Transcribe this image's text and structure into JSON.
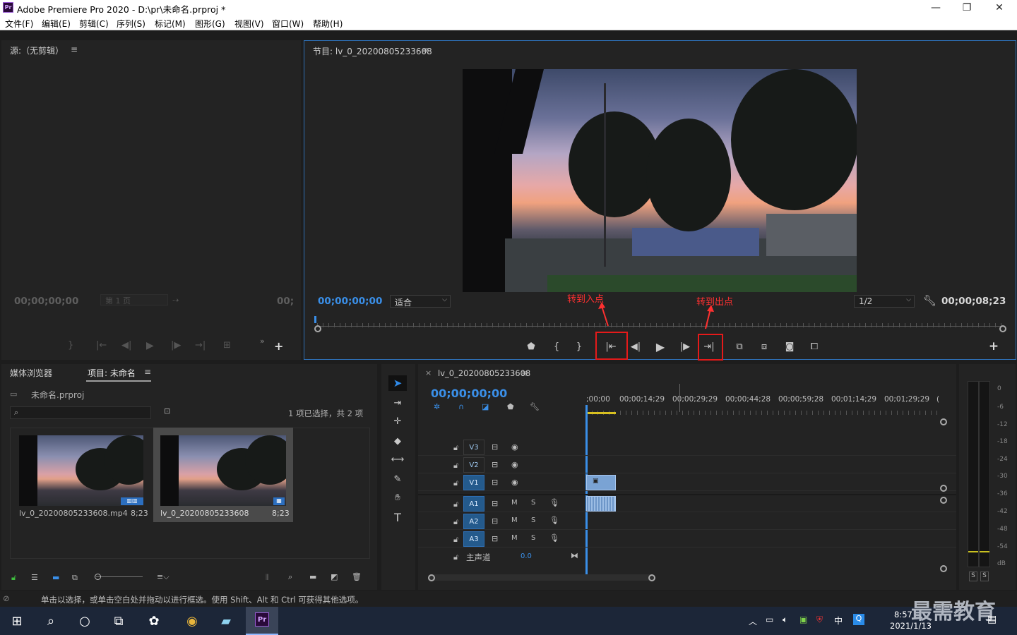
{
  "window": {
    "app_badge": "Pr",
    "title": "Adobe Premiere Pro 2020 - D:\\pr\\未命名.prproj *",
    "min": "—",
    "max": "❐",
    "close": "✕"
  },
  "menu": [
    "文件(F)",
    "编辑(E)",
    "剪辑(C)",
    "序列(S)",
    "标记(M)",
    "图形(G)",
    "视图(V)",
    "窗口(W)",
    "帮助(H)"
  ],
  "source": {
    "title": "源:（无剪辑）",
    "timecode_left": "00;00;00;00",
    "page": "第 1 页",
    "timecode_right": "00;"
  },
  "program": {
    "title": "节目: lv_0_20200805233608",
    "timecode": "00;00;00;00",
    "fit": "适合",
    "resolution": "1/2",
    "duration": "00;00;08;23",
    "annotation_in": "转到入点",
    "annotation_out": "转到出点"
  },
  "project": {
    "tab_media": "媒体浏览器",
    "tab_project": "项目: 未命名",
    "file": "未命名.prproj",
    "selection": "1 项已选择，共 2 项",
    "items": [
      {
        "name": "lv_0_20200805233608.mp4",
        "dur": "8;23"
      },
      {
        "name": "lv_0_20200805233608",
        "dur": "8;23"
      }
    ]
  },
  "timeline": {
    "seq_name": "lv_0_20200805233608",
    "timecode": "00;00;00;00",
    "ruler": [
      ";00;00",
      "00;00;14;29",
      "00;00;29;29",
      "00;00;44;28",
      "00;00;59;28",
      "00;01;14;29",
      "00;01;29;29",
      "("
    ],
    "video_tracks": [
      "V3",
      "V2",
      "V1"
    ],
    "audio_tracks": [
      "A1",
      "A2",
      "A3"
    ],
    "master": "主声道",
    "master_val": "0.0",
    "m": "M",
    "s": "S"
  },
  "meters": {
    "labels": [
      "0",
      "-6",
      "-12",
      "-18",
      "-24",
      "-30",
      "-36",
      "-42",
      "-48",
      "-54",
      "dB"
    ],
    "solo": "S"
  },
  "status": "单击以选择，或单击空白处并拖动以进行框选。使用 Shift、Alt 和 Ctrl 可获得其他选项。",
  "taskbar": {
    "time": "8:57",
    "date": "2021/1/13",
    "ime": "中",
    "watermark": "最需教育"
  }
}
